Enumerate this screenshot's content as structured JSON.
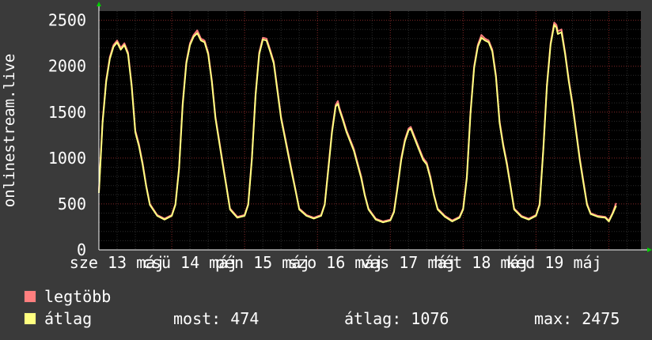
{
  "chart_data": {
    "type": "line",
    "ylabel": "onlinestream.live",
    "ylim": [
      0,
      2600
    ],
    "yticks": [
      0,
      500,
      1000,
      1500,
      2000,
      2500
    ],
    "xlim": [
      0,
      7.44
    ],
    "xticks": [
      {
        "x": 0.25,
        "label": "sze 13 máj"
      },
      {
        "x": 1.25,
        "label": "csü 14 máj"
      },
      {
        "x": 2.25,
        "label": "pén 15 máj"
      },
      {
        "x": 3.25,
        "label": "szo 16 máj"
      },
      {
        "x": 4.25,
        "label": "vas 17 máj"
      },
      {
        "x": 5.25,
        "label": "hét 18 máj"
      },
      {
        "x": 6.25,
        "label": "ked 19 máj"
      }
    ],
    "grid": true,
    "series": [
      {
        "name": "legtöbb",
        "color": "#ff7f7f",
        "points": [
          [
            0,
            650
          ],
          [
            0.05,
            1400
          ],
          [
            0.1,
            1850
          ],
          [
            0.15,
            2100
          ],
          [
            0.2,
            2230
          ],
          [
            0.25,
            2280
          ],
          [
            0.3,
            2200
          ],
          [
            0.35,
            2250
          ],
          [
            0.4,
            2150
          ],
          [
            0.45,
            1800
          ],
          [
            0.5,
            1300
          ],
          [
            0.55,
            1150
          ],
          [
            0.6,
            950
          ],
          [
            0.65,
            700
          ],
          [
            0.7,
            500
          ],
          [
            0.8,
            380
          ],
          [
            0.9,
            340
          ],
          [
            1.0,
            380
          ],
          [
            1.05,
            500
          ],
          [
            1.1,
            900
          ],
          [
            1.15,
            1600
          ],
          [
            1.2,
            2050
          ],
          [
            1.25,
            2250
          ],
          [
            1.3,
            2340
          ],
          [
            1.35,
            2390
          ],
          [
            1.4,
            2300
          ],
          [
            1.45,
            2280
          ],
          [
            1.5,
            2150
          ],
          [
            1.55,
            1850
          ],
          [
            1.6,
            1450
          ],
          [
            1.65,
            1200
          ],
          [
            1.7,
            950
          ],
          [
            1.75,
            700
          ],
          [
            1.8,
            450
          ],
          [
            1.9,
            360
          ],
          [
            2.0,
            380
          ],
          [
            2.05,
            500
          ],
          [
            2.1,
            1000
          ],
          [
            2.15,
            1700
          ],
          [
            2.2,
            2150
          ],
          [
            2.25,
            2310
          ],
          [
            2.3,
            2300
          ],
          [
            2.35,
            2180
          ],
          [
            2.4,
            2050
          ],
          [
            2.45,
            1750
          ],
          [
            2.5,
            1450
          ],
          [
            2.55,
            1250
          ],
          [
            2.6,
            1050
          ],
          [
            2.65,
            850
          ],
          [
            2.7,
            650
          ],
          [
            2.75,
            450
          ],
          [
            2.85,
            380
          ],
          [
            2.95,
            350
          ],
          [
            3.05,
            380
          ],
          [
            3.1,
            500
          ],
          [
            3.15,
            900
          ],
          [
            3.2,
            1300
          ],
          [
            3.25,
            1580
          ],
          [
            3.28,
            1620
          ],
          [
            3.3,
            1550
          ],
          [
            3.35,
            1430
          ],
          [
            3.4,
            1300
          ],
          [
            3.45,
            1200
          ],
          [
            3.5,
            1100
          ],
          [
            3.55,
            950
          ],
          [
            3.6,
            800
          ],
          [
            3.65,
            600
          ],
          [
            3.7,
            450
          ],
          [
            3.8,
            340
          ],
          [
            3.9,
            310
          ],
          [
            4.0,
            330
          ],
          [
            4.05,
            420
          ],
          [
            4.1,
            700
          ],
          [
            4.15,
            1000
          ],
          [
            4.2,
            1200
          ],
          [
            4.25,
            1320
          ],
          [
            4.28,
            1340
          ],
          [
            4.32,
            1260
          ],
          [
            4.4,
            1100
          ],
          [
            4.45,
            1000
          ],
          [
            4.5,
            950
          ],
          [
            4.55,
            800
          ],
          [
            4.6,
            600
          ],
          [
            4.65,
            450
          ],
          [
            4.75,
            370
          ],
          [
            4.85,
            320
          ],
          [
            4.95,
            360
          ],
          [
            5.0,
            450
          ],
          [
            5.05,
            800
          ],
          [
            5.1,
            1500
          ],
          [
            5.15,
            2000
          ],
          [
            5.2,
            2230
          ],
          [
            5.25,
            2340
          ],
          [
            5.3,
            2300
          ],
          [
            5.35,
            2280
          ],
          [
            5.4,
            2180
          ],
          [
            5.45,
            1900
          ],
          [
            5.5,
            1400
          ],
          [
            5.55,
            1150
          ],
          [
            5.6,
            950
          ],
          [
            5.65,
            700
          ],
          [
            5.7,
            450
          ],
          [
            5.8,
            370
          ],
          [
            5.9,
            340
          ],
          [
            6.0,
            380
          ],
          [
            6.05,
            500
          ],
          [
            6.1,
            1100
          ],
          [
            6.15,
            1800
          ],
          [
            6.2,
            2250
          ],
          [
            6.25,
            2475
          ],
          [
            6.28,
            2450
          ],
          [
            6.3,
            2380
          ],
          [
            6.35,
            2400
          ],
          [
            6.4,
            2150
          ],
          [
            6.45,
            1850
          ],
          [
            6.5,
            1600
          ],
          [
            6.55,
            1300
          ],
          [
            6.6,
            1000
          ],
          [
            6.65,
            750
          ],
          [
            6.7,
            500
          ],
          [
            6.75,
            400
          ],
          [
            6.85,
            370
          ],
          [
            6.95,
            360
          ],
          [
            7.0,
            320
          ],
          [
            7.05,
            400
          ],
          [
            7.1,
            510
          ]
        ]
      },
      {
        "name": "átlag",
        "color": "#ffff80",
        "points": [
          [
            0,
            620
          ],
          [
            0.05,
            1380
          ],
          [
            0.1,
            1830
          ],
          [
            0.15,
            2080
          ],
          [
            0.2,
            2210
          ],
          [
            0.25,
            2260
          ],
          [
            0.3,
            2180
          ],
          [
            0.35,
            2230
          ],
          [
            0.4,
            2130
          ],
          [
            0.45,
            1780
          ],
          [
            0.5,
            1280
          ],
          [
            0.55,
            1130
          ],
          [
            0.6,
            930
          ],
          [
            0.65,
            690
          ],
          [
            0.7,
            490
          ],
          [
            0.8,
            370
          ],
          [
            0.9,
            330
          ],
          [
            1.0,
            370
          ],
          [
            1.05,
            490
          ],
          [
            1.1,
            880
          ],
          [
            1.15,
            1580
          ],
          [
            1.2,
            2030
          ],
          [
            1.25,
            2230
          ],
          [
            1.3,
            2320
          ],
          [
            1.35,
            2360
          ],
          [
            1.4,
            2280
          ],
          [
            1.45,
            2260
          ],
          [
            1.5,
            2130
          ],
          [
            1.55,
            1830
          ],
          [
            1.6,
            1430
          ],
          [
            1.65,
            1180
          ],
          [
            1.7,
            930
          ],
          [
            1.75,
            690
          ],
          [
            1.8,
            440
          ],
          [
            1.9,
            350
          ],
          [
            2.0,
            370
          ],
          [
            2.05,
            490
          ],
          [
            2.1,
            980
          ],
          [
            2.15,
            1680
          ],
          [
            2.2,
            2130
          ],
          [
            2.25,
            2290
          ],
          [
            2.3,
            2280
          ],
          [
            2.35,
            2160
          ],
          [
            2.4,
            2030
          ],
          [
            2.45,
            1730
          ],
          [
            2.5,
            1430
          ],
          [
            2.55,
            1230
          ],
          [
            2.6,
            1030
          ],
          [
            2.65,
            830
          ],
          [
            2.7,
            640
          ],
          [
            2.75,
            440
          ],
          [
            2.85,
            370
          ],
          [
            2.95,
            340
          ],
          [
            3.05,
            370
          ],
          [
            3.1,
            490
          ],
          [
            3.15,
            880
          ],
          [
            3.2,
            1280
          ],
          [
            3.25,
            1560
          ],
          [
            3.28,
            1590
          ],
          [
            3.3,
            1530
          ],
          [
            3.35,
            1410
          ],
          [
            3.4,
            1280
          ],
          [
            3.45,
            1180
          ],
          [
            3.5,
            1080
          ],
          [
            3.55,
            930
          ],
          [
            3.6,
            780
          ],
          [
            3.65,
            590
          ],
          [
            3.7,
            440
          ],
          [
            3.8,
            330
          ],
          [
            3.9,
            300
          ],
          [
            4.0,
            320
          ],
          [
            4.05,
            410
          ],
          [
            4.1,
            680
          ],
          [
            4.15,
            980
          ],
          [
            4.2,
            1180
          ],
          [
            4.25,
            1300
          ],
          [
            4.28,
            1320
          ],
          [
            4.32,
            1240
          ],
          [
            4.4,
            1080
          ],
          [
            4.45,
            980
          ],
          [
            4.5,
            930
          ],
          [
            4.55,
            780
          ],
          [
            4.6,
            590
          ],
          [
            4.65,
            440
          ],
          [
            4.75,
            360
          ],
          [
            4.85,
            310
          ],
          [
            4.95,
            350
          ],
          [
            5.0,
            440
          ],
          [
            5.05,
            780
          ],
          [
            5.1,
            1480
          ],
          [
            5.15,
            1980
          ],
          [
            5.2,
            2210
          ],
          [
            5.25,
            2310
          ],
          [
            5.3,
            2280
          ],
          [
            5.35,
            2260
          ],
          [
            5.4,
            2160
          ],
          [
            5.45,
            1880
          ],
          [
            5.5,
            1380
          ],
          [
            5.55,
            1130
          ],
          [
            5.6,
            930
          ],
          [
            5.65,
            690
          ],
          [
            5.7,
            440
          ],
          [
            5.8,
            360
          ],
          [
            5.9,
            330
          ],
          [
            6.0,
            370
          ],
          [
            6.05,
            490
          ],
          [
            6.1,
            1080
          ],
          [
            6.15,
            1780
          ],
          [
            6.2,
            2230
          ],
          [
            6.25,
            2450
          ],
          [
            6.28,
            2420
          ],
          [
            6.3,
            2350
          ],
          [
            6.35,
            2370
          ],
          [
            6.4,
            2130
          ],
          [
            6.45,
            1830
          ],
          [
            6.5,
            1580
          ],
          [
            6.55,
            1280
          ],
          [
            6.6,
            980
          ],
          [
            6.65,
            730
          ],
          [
            6.7,
            490
          ],
          [
            6.75,
            390
          ],
          [
            6.85,
            360
          ],
          [
            6.95,
            350
          ],
          [
            7.0,
            310
          ],
          [
            7.05,
            390
          ],
          [
            7.1,
            480
          ]
        ]
      }
    ]
  },
  "legend": {
    "items": [
      {
        "label": "legtöbb",
        "color": "#ff7f7f"
      },
      {
        "label": "átlag",
        "color": "#ffff80"
      }
    ]
  },
  "stats": {
    "most": "most: 474",
    "atlag": "átlag: 1076",
    "max": "max: 2475"
  }
}
